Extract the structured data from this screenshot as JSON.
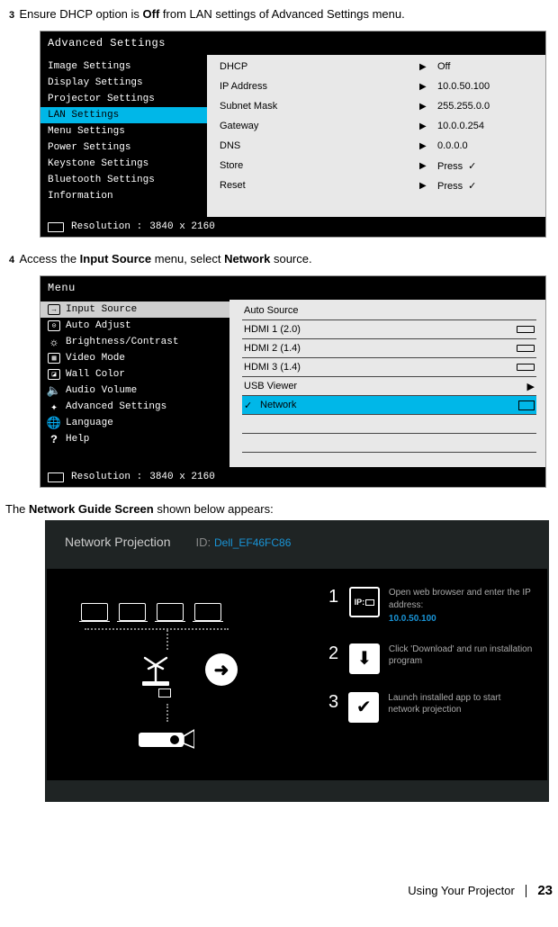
{
  "step3": {
    "num": "3",
    "pre": "Ensure DHCP option is ",
    "bold": "Off",
    "post": " from LAN settings of Advanced Settings menu."
  },
  "adv_panel": {
    "title": "Advanced Settings",
    "sidebar": [
      {
        "label": "Image Settings"
      },
      {
        "label": "Display Settings"
      },
      {
        "label": "Projector Settings"
      },
      {
        "label": "LAN Settings",
        "selected": true
      },
      {
        "label": "Menu Settings"
      },
      {
        "label": "Power Settings"
      },
      {
        "label": "Keystone Settings"
      },
      {
        "label": "Bluetooth Settings"
      },
      {
        "label": "Information"
      }
    ],
    "rows": [
      {
        "label": "DHCP",
        "value": "Off"
      },
      {
        "label": "IP Address",
        "value": "10.0.50.100"
      },
      {
        "label": "Subnet Mask",
        "value": "255.255.0.0"
      },
      {
        "label": "Gateway",
        "value": "10.0.0.254"
      },
      {
        "label": "DNS",
        "value": "0.0.0.0"
      },
      {
        "label": "Store",
        "value": "Press",
        "check": true
      },
      {
        "label": "Reset",
        "value": "Press",
        "check": true
      }
    ],
    "resolution_label": "Resolution :",
    "resolution_value": "3840 x 2160"
  },
  "step4": {
    "num": "4",
    "pre": "Access the ",
    "bold1": "Input Source",
    "mid": " menu, select ",
    "bold2": "Network",
    "post": " source."
  },
  "menu_panel": {
    "title": "Menu",
    "sidebar": [
      {
        "label": "Input Source",
        "selected": true,
        "icon": "arrow-in"
      },
      {
        "label": "Auto Adjust",
        "icon": "target"
      },
      {
        "label": "Brightness/Contrast",
        "icon": "sun"
      },
      {
        "label": "Video Mode",
        "icon": "film"
      },
      {
        "label": "Wall Color",
        "icon": "wall"
      },
      {
        "label": "Audio Volume",
        "icon": "speaker"
      },
      {
        "label": "Advanced Settings",
        "icon": "gear"
      },
      {
        "label": "Language",
        "icon": "globe"
      },
      {
        "label": "Help",
        "icon": "help"
      }
    ],
    "sources": [
      {
        "label": "Auto Source"
      },
      {
        "label": "HDMI 1 (2.0)",
        "port": true
      },
      {
        "label": "HDMI 2 (1.4)",
        "port": true
      },
      {
        "label": "HDMI 3 (1.4)",
        "port": true
      },
      {
        "label": "USB Viewer",
        "arrow": true
      },
      {
        "label": "Network",
        "selected": true,
        "check": true,
        "screen": true
      }
    ],
    "resolution_label": "Resolution :",
    "resolution_value": "3840 x 2160"
  },
  "guide_intro": {
    "pre": "The ",
    "bold": "Network Guide Screen",
    "post": " shown below appears:"
  },
  "netguide": {
    "title": "Network Projection",
    "id_label": "ID:",
    "id_value": "Dell_EF46FC86",
    "steps": [
      {
        "n": "1",
        "icon_text": "IP:",
        "desc": "Open web browser and enter the IP address:",
        "ip": "10.0.50.100"
      },
      {
        "n": "2",
        "desc": "Click 'Download' and run installation program"
      },
      {
        "n": "3",
        "desc": "Launch installed app to start network projection"
      }
    ]
  },
  "footer": {
    "text": "Using Your Projector",
    "page": "23"
  }
}
